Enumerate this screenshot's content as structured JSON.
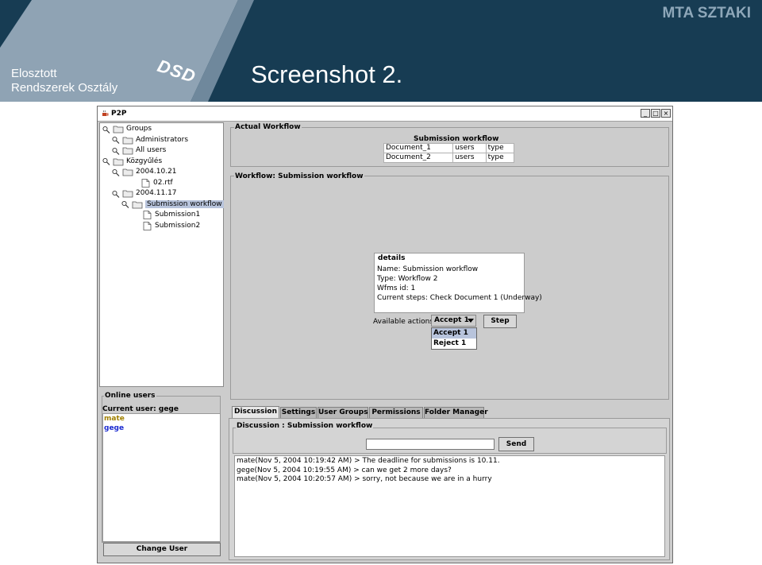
{
  "slide": {
    "org_line1": "Elosztott",
    "org_line2": "Rendszerek Osztály",
    "logo": "DSD",
    "title": "Screenshot 2.",
    "brand": "MTA SZTAKI",
    "colors": {
      "header_bg": "#173c53",
      "wedge": "#8fa3b4",
      "brand": "#8ea7b9"
    }
  },
  "window": {
    "title": "P2P",
    "controls": {
      "minimize": "_",
      "maximize": "□",
      "close": "×"
    }
  },
  "tree": {
    "items": [
      {
        "label": "Groups",
        "icon": "folder-icon"
      },
      {
        "label": "Administrators",
        "icon": "folder-icon"
      },
      {
        "label": "All users",
        "icon": "folder-icon"
      },
      {
        "label": "Közgyűlés",
        "icon": "folder-icon"
      },
      {
        "label": "2004.10.21",
        "icon": "folder-icon"
      },
      {
        "label": "02.rtf",
        "icon": "file-icon"
      },
      {
        "label": "2004.11.17",
        "icon": "folder-icon"
      },
      {
        "label": "Submission workflow",
        "icon": "folder-icon",
        "selected": true
      },
      {
        "label": "Submission1",
        "icon": "file-icon"
      },
      {
        "label": "Submission2",
        "icon": "file-icon"
      }
    ]
  },
  "online_users": {
    "title": "Online users",
    "current_user": "Current user: gege",
    "users": [
      {
        "name": "mate",
        "color": "#a08000"
      },
      {
        "name": "gege",
        "color": "#1a2ad0"
      }
    ],
    "change_user_label": "Change User"
  },
  "actual_workflow": {
    "title": "Actual Workflow",
    "table_title": "Submission workflow",
    "rows": [
      [
        "Document_1",
        "users",
        "type"
      ],
      [
        "Document_2",
        "users",
        "type"
      ]
    ]
  },
  "workflow": {
    "title": "Workflow: Submission workflow",
    "details_title": "details",
    "details_lines": [
      "Name: Submission workflow",
      "Type: Workflow 2",
      "Wfms id: 1",
      "Current steps: Check Document 1 (Underway)"
    ],
    "actions_label": "Available actions:",
    "selected_action": "Accept 1",
    "step_label": "Step",
    "options": [
      "Accept 1",
      "Reject 1"
    ]
  },
  "tabs": [
    {
      "label": "Discussion",
      "active": true
    },
    {
      "label": "Settings"
    },
    {
      "label": "User Groups"
    },
    {
      "label": "Permissions"
    },
    {
      "label": "Folder Manager"
    }
  ],
  "discussion": {
    "title": "Discussion : Submission workflow",
    "input_value": "",
    "send_label": "Send",
    "messages": [
      "mate(Nov 5, 2004 10:19:42 AM) > The deadline for submissions is 10.11.",
      "gege(Nov 5, 2004 10:19:55 AM) > can we get 2 more days?",
      "mate(Nov 5, 2004 10:20:57 AM) > sorry, not because we are in a hurry"
    ]
  }
}
